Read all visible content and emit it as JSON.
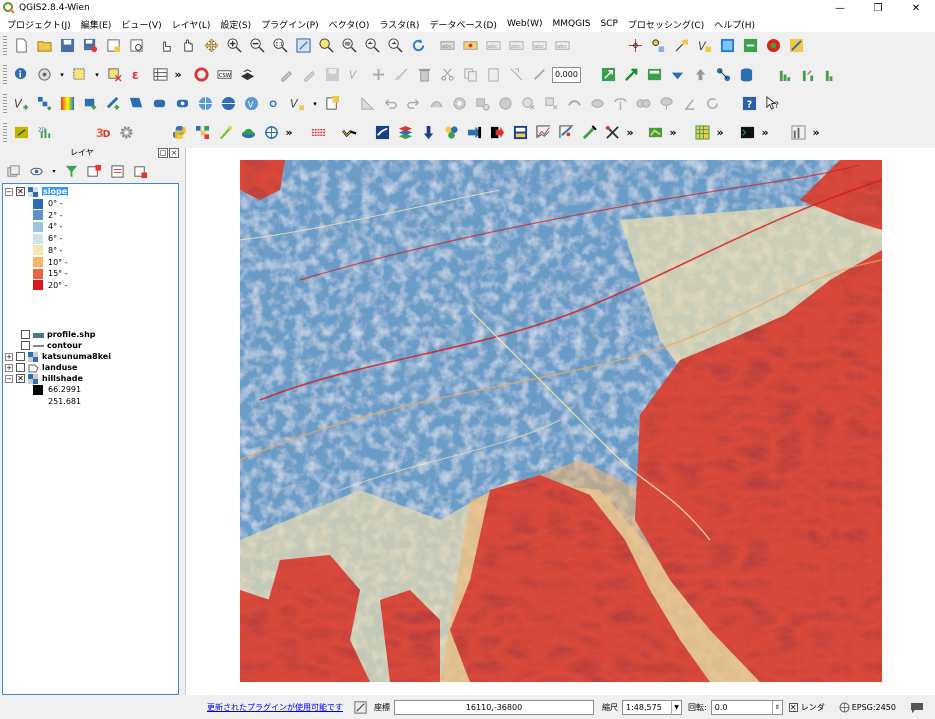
{
  "window": {
    "title": "QGIS2.8.4-Wien"
  },
  "menus": [
    "プロジェクト(J)",
    "編集(E)",
    "ビュー(V)",
    "レイヤ(L)",
    "設定(S)",
    "プラグイン(P)",
    "ベクタ(O)",
    "ラスタ(R)",
    "データベース(D)",
    "Web(W)",
    "MMQGIS",
    "SCP",
    "プロセッシング(C)",
    "ヘルプ(H)"
  ],
  "toolbar": {
    "scale_field": "0.000"
  },
  "layers_panel": {
    "title": "レイヤ",
    "float_label": "□",
    "close_label": "×",
    "layers": [
      {
        "name": "slope",
        "checked": true,
        "selected": true,
        "icon": "raster-icon"
      },
      {
        "name": "profile.shp",
        "checked": false,
        "icon": "line-layer-icon"
      },
      {
        "name": "contour",
        "checked": false,
        "icon": "line-layer-icon"
      },
      {
        "name": "katsunuma8kei",
        "checked": false,
        "icon": "raster-icon"
      },
      {
        "name": "landuse",
        "checked": false,
        "icon": "polygon-layer-icon"
      },
      {
        "name": "hillshade",
        "checked": true,
        "icon": "raster-icon"
      }
    ],
    "slope_legend": [
      {
        "label": "0° -",
        "color": "#2b6fb0"
      },
      {
        "label": "2° -",
        "color": "#5b95c7"
      },
      {
        "label": "4° -",
        "color": "#9dc4de"
      },
      {
        "label": "6° -",
        "color": "#cfe3ea"
      },
      {
        "label": "8° -",
        "color": "#f5e7b4"
      },
      {
        "label": "10° -",
        "color": "#f8b668"
      },
      {
        "label": "15° -",
        "color": "#e8643f"
      },
      {
        "label": "20° -",
        "color": "#d7191c"
      }
    ],
    "hillshade_legend": [
      {
        "label": "66.2991",
        "color": "#000000"
      },
      {
        "label": "251.681",
        "color": "#ffffff"
      }
    ]
  },
  "status": {
    "plugin_link": "更新されたプラグインが使用可能です",
    "coord_label": "座標",
    "coord_value": "16110,-36800",
    "scale_label": "縮尺",
    "scale_value": "1:48,575",
    "rotation_label": "回転:",
    "rotation_value": "0.0",
    "render_label": "レンダ",
    "crs": "EPSG:2450"
  }
}
